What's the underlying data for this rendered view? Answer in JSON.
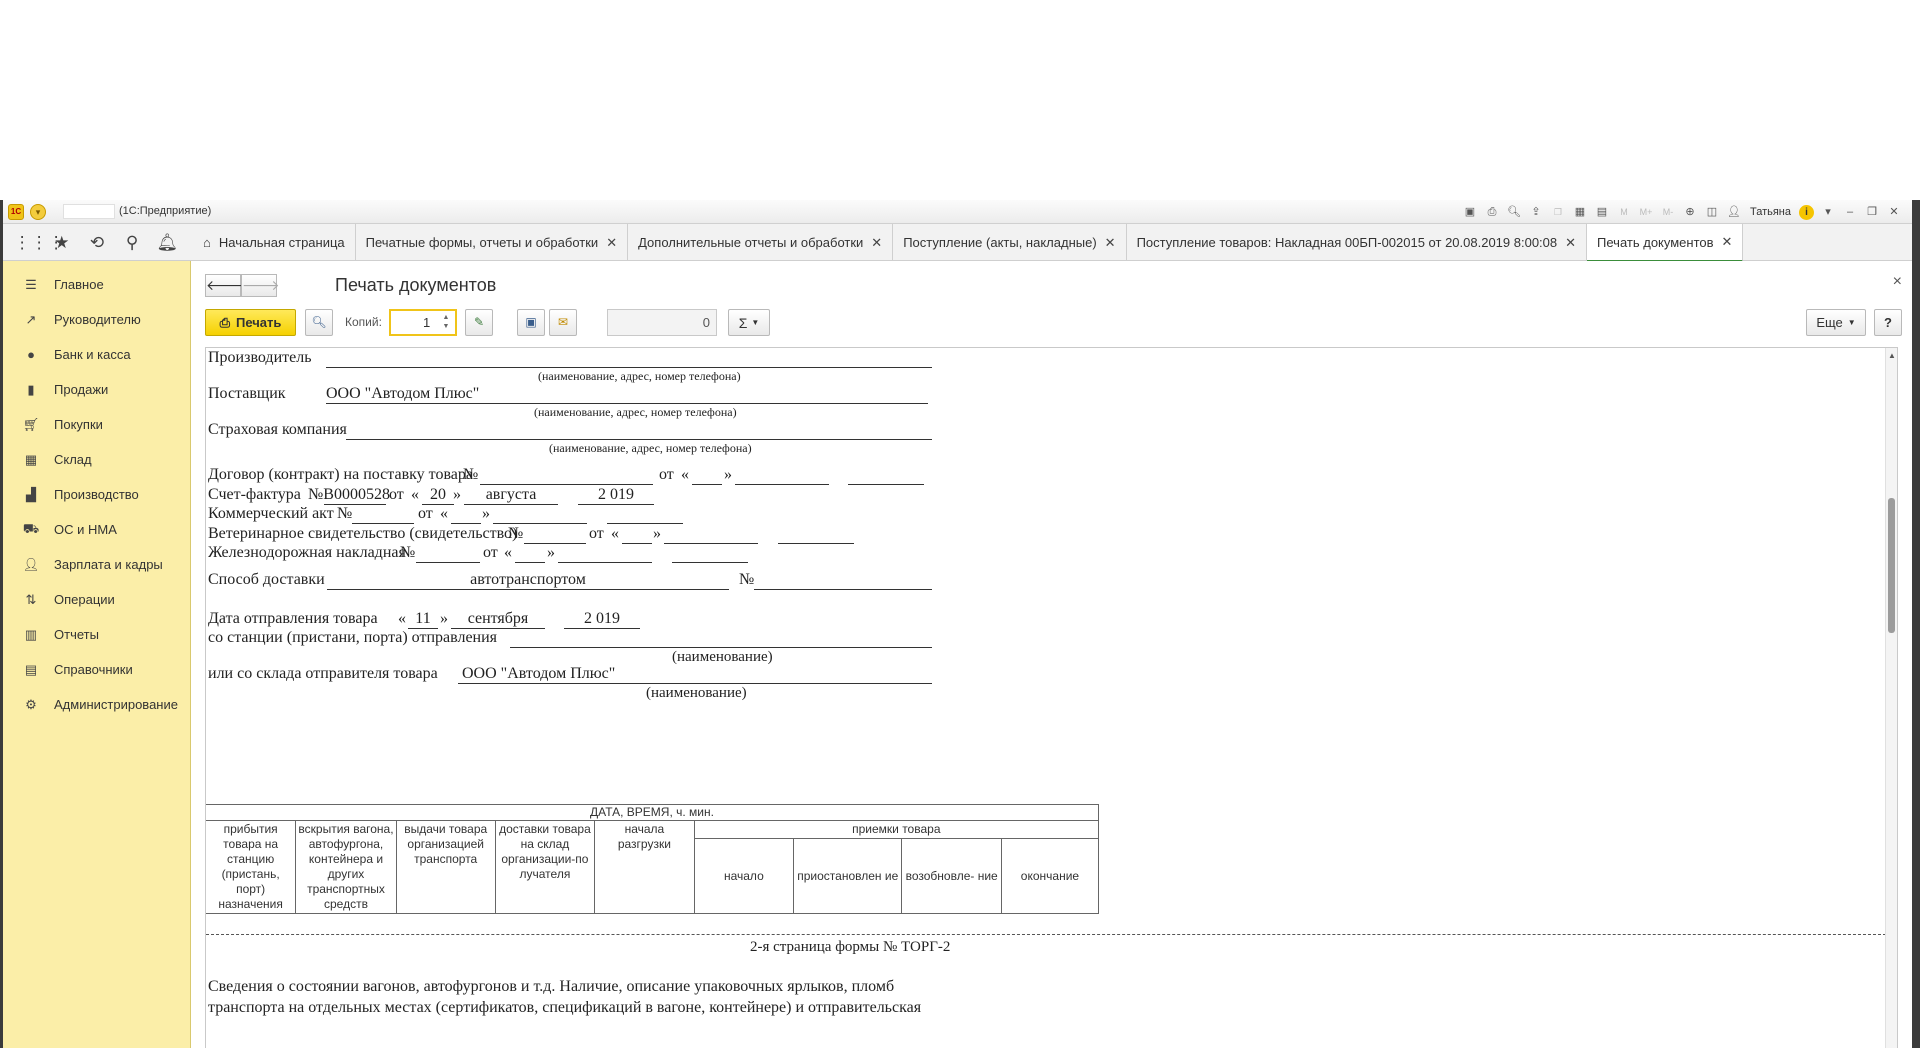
{
  "window": {
    "title": "(1С:Предприятие)",
    "user": "Татьяна"
  },
  "titlebar_icons": [
    "save-icon",
    "print-icon",
    "preview-icon",
    "upload-icon",
    "copy-icon",
    "table-icon",
    "calendar-icon",
    "M",
    "M+",
    "M-",
    "zoom-icon",
    "panel-icon"
  ],
  "sections": {
    "tabs": [
      {
        "label": "Начальная страница",
        "closable": false
      },
      {
        "label": "Печатные формы, отчеты и обработки",
        "closable": true
      },
      {
        "label": "Дополнительные отчеты и обработки",
        "closable": true
      },
      {
        "label": "Поступление (акты, накладные)",
        "closable": true
      },
      {
        "label": "Поступление товаров: Накладная 00БП-002015 от 20.08.2019 8:00:08",
        "closable": true
      },
      {
        "label": "Печать документов",
        "closable": true
      }
    ]
  },
  "sidebar": {
    "items": [
      {
        "label": "Главное",
        "icon": "menu-icon"
      },
      {
        "label": "Руководителю",
        "icon": "trend-icon"
      },
      {
        "label": "Банк и касса",
        "icon": "coin-icon"
      },
      {
        "label": "Продажи",
        "icon": "bag-icon"
      },
      {
        "label": "Покупки",
        "icon": "cart-icon"
      },
      {
        "label": "Склад",
        "icon": "warehouse-icon"
      },
      {
        "label": "Производство",
        "icon": "factory-icon"
      },
      {
        "label": "ОС и НМА",
        "icon": "truck-icon"
      },
      {
        "label": "Зарплата и кадры",
        "icon": "person-icon"
      },
      {
        "label": "Операции",
        "icon": "operations-icon"
      },
      {
        "label": "Отчеты",
        "icon": "report-icon"
      },
      {
        "label": "Справочники",
        "icon": "book-icon"
      },
      {
        "label": "Администрирование",
        "icon": "gear-icon"
      }
    ]
  },
  "page": {
    "title": "Печать документов",
    "print_label": "Печать",
    "copies_label": "Копий:",
    "copies_value": "1",
    "sum_value": "0",
    "sum_symbol": "Σ",
    "more_label": "Еще",
    "help_label": "?"
  },
  "doc": {
    "producer_label": "Производитель",
    "hint_name_address_phone": "(наименование, адрес, номер телефона)",
    "supplier_label": "Поставщик",
    "supplier_value": "ООО \"Автодом Плюс\"",
    "insurance_label": "Страховая компания",
    "contract_label": "Договор (контракт) на поставку товара",
    "no_sign": "№",
    "from_label": "от",
    "q_open": "«",
    "q_close": "»",
    "invoice_label": "Счет-фактура",
    "invoice_no": "№В0000528",
    "invoice_day": "20",
    "invoice_month": "августа",
    "invoice_year": "2 019",
    "commercial_act_label": "Коммерческий акт",
    "vet_label": "Ветеринарное свидетельство (свидетельство)",
    "rail_label": "Железнодорожная накладная",
    "delivery_label": "Способ доставки",
    "delivery_value": "автотранспортом",
    "ship_date_label": "Дата отправления товара",
    "ship_day": "11",
    "ship_month": "сентября",
    "ship_year": "2 019",
    "station_label": "со станции (пристани, порта) отправления",
    "hint_name": "(наименование)",
    "warehouse_label": "или со склада отправителя товара",
    "warehouse_value": "ООО \"Автодом Плюс\"",
    "table": {
      "header": "ДАТА, ВРЕМЯ, ч. мин.",
      "col1": "прибытия товара на станцию (пристань, порт) назначения",
      "col2": "вскрытия вагона, автофургона, контейнера и других транспортных средств",
      "col3": "выдачи товара организацией транспорта",
      "col4": "доставки товара на склад организации-по лучателя",
      "col5": "начала разгрузки",
      "acceptance": "приемки товара",
      "sub1": "начало",
      "sub2": "приостановлен ие",
      "sub3": "возобновле- ние",
      "sub4": "окончание"
    },
    "page2_label": "2-я страница формы № ТОРГ-2",
    "info_line1": "Сведения о состоянии вагонов, автофургонов и т.д. Наличие, описание упаковочных ярлыков, пломб",
    "info_line2": "транспорта на отдельных местах (сертификатов, спецификаций в вагоне, контейнере) и отправительская"
  }
}
